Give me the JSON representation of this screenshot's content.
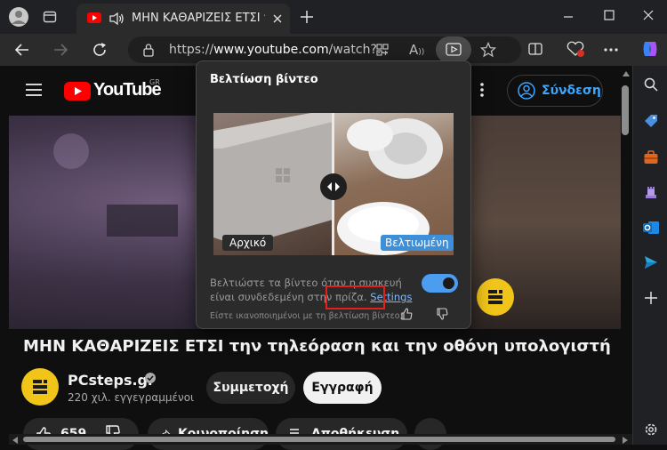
{
  "browser": {
    "tab_title": "ΜΗΝ ΚΑΘΑΡΙΖΕΙΣ ΕΤΣΙ την",
    "url_scheme": "https://",
    "url_host": "www.youtube.com",
    "url_path": "/watch?..."
  },
  "youtube": {
    "logo_text": "YouTube",
    "region": "GR",
    "signin_label": "Σύνδεση",
    "video_title": "ΜΗΝ ΚΑΘΑΡΙΖΕΙΣ ΕΤΣΙ την τηλεόραση και την οθόνη υπολογιστή",
    "channel_name": "PCsteps.gr",
    "subscribers": "220 χιλ. εγγεγραμμένοι",
    "join_label": "Συμμετοχή",
    "subscribe_label": "Εγγραφή",
    "like_count": "659",
    "share_label": "Κοινοποίηση",
    "save_label": "Αποθήκευση"
  },
  "popup": {
    "title": "Βελτίωση βίντεο",
    "label_original": "Αρχικό",
    "label_enhanced": "Βελτιωμένη",
    "description": "Βελτιώστε τα βίντεο όταν η συσκευή είναι συνδεδεμένη στην πρίζα.",
    "settings_link": "Settings",
    "feedback_prompt": "Είστε ικανοποιημένοι με τη βελτίωση βίντεο;",
    "toggle_on": true
  },
  "colors": {
    "youtube_red": "#ff0000",
    "toggle_accent": "#4c9df0",
    "highlight_box": "#e2201c",
    "channel_avatar": "#f0c419"
  }
}
